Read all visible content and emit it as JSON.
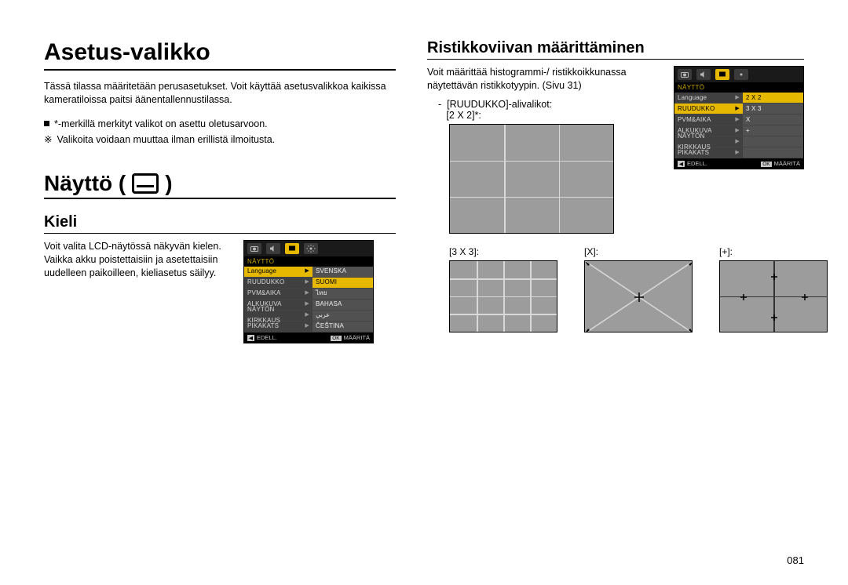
{
  "h1": "Asetus-valikko",
  "intro": "Tässä tilassa määritetään perusasetukset. Voit käyttää asetusvalikkoa kaikissa kameratiloissa paitsi äänentallennustilassa.",
  "bullet1": "*-merkillä merkityt valikot on asettu oletusarvoon.",
  "bullet2": "Valikoita voidaan muuttaa ilman erillistä ilmoitusta.",
  "h1b": "Näyttö (",
  "h1b_close": ")",
  "h2_kieli": "Kieli",
  "kieli_text": "Voit valita LCD-näytössä näkyvän kielen. Vaikka akku poistettaisiin ja asetettaisiin uudelleen paikoilleen, kieliasetus säilyy.",
  "h2_rist": "Ristikkoviivan määrittäminen",
  "rist_text": "Voit määrittää histogrammi-/ ristikkoikkunassa näytettävän ristikkotyypin. (Sivu 31)",
  "grid_note_dash": "-",
  "grid_note": "[RUUDUKKO]-alivalikot:",
  "label_2x2": "[2 X 2]*:",
  "label_3x3": "[3 X 3]:",
  "label_x": "[X]:",
  "label_plus": "[+]:",
  "menu": {
    "title": "NÄYTTÖ",
    "items": [
      "Language",
      "RUUDUKKO",
      "PVM&AIKA",
      "ALKUKUVA",
      "NÄYTÖN KIRKKAUS",
      "PIKAKATS"
    ],
    "kieli_sub": [
      "SVENSKA",
      "SUOMI",
      "ไทย",
      "BAHASA",
      "عربي",
      "ČEŠTINA"
    ],
    "grid_sub": [
      "2 X 2",
      "3 X 3",
      "X",
      "+"
    ],
    "foot_prev_k": "◀",
    "foot_prev": "EDELL.",
    "foot_ok_k": "OK",
    "foot_ok": "MÄÄRITÄ"
  },
  "page": "081"
}
